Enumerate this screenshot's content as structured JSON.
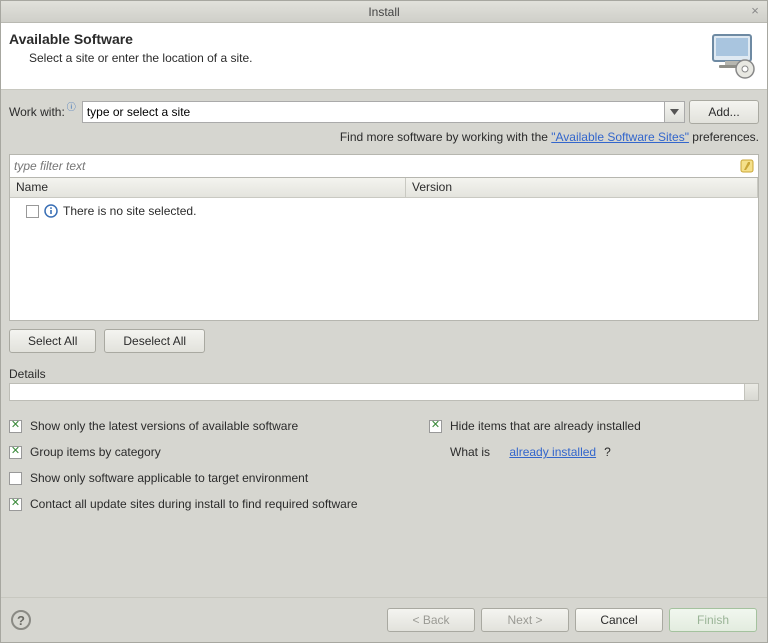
{
  "window": {
    "title": "Install"
  },
  "banner": {
    "heading": "Available Software",
    "subtitle": "Select a site or enter the location of a site."
  },
  "workwith": {
    "label": "Work with:",
    "value": "type or select a site",
    "add_button": "Add..."
  },
  "helptext": {
    "prefix": "Find more software by working with the ",
    "link": "\"Available Software Sites\"",
    "suffix": " preferences."
  },
  "filter": {
    "placeholder": "type filter text"
  },
  "table": {
    "columns": {
      "name": "Name",
      "version": "Version"
    },
    "empty_row": {
      "text": "There is no site selected."
    }
  },
  "buttons": {
    "select_all": "Select All",
    "deselect_all": "Deselect All"
  },
  "details": {
    "label": "Details"
  },
  "options": {
    "latest_versions": {
      "label": "Show only the latest versions of available software",
      "checked": true
    },
    "group_by_category": {
      "label": "Group items by category",
      "checked": true
    },
    "applicable_target": {
      "label": "Show only software applicable to target environment",
      "checked": false
    },
    "contact_update_sites": {
      "label": "Contact all update sites during install to find required software",
      "checked": true
    },
    "hide_installed": {
      "label": "Hide items that are already installed",
      "checked": true
    },
    "already_installed": {
      "prefix": "What is ",
      "link": "already installed",
      "suffix": "?"
    }
  },
  "footer": {
    "back": "< Back",
    "next": "Next >",
    "cancel": "Cancel",
    "finish": "Finish"
  }
}
